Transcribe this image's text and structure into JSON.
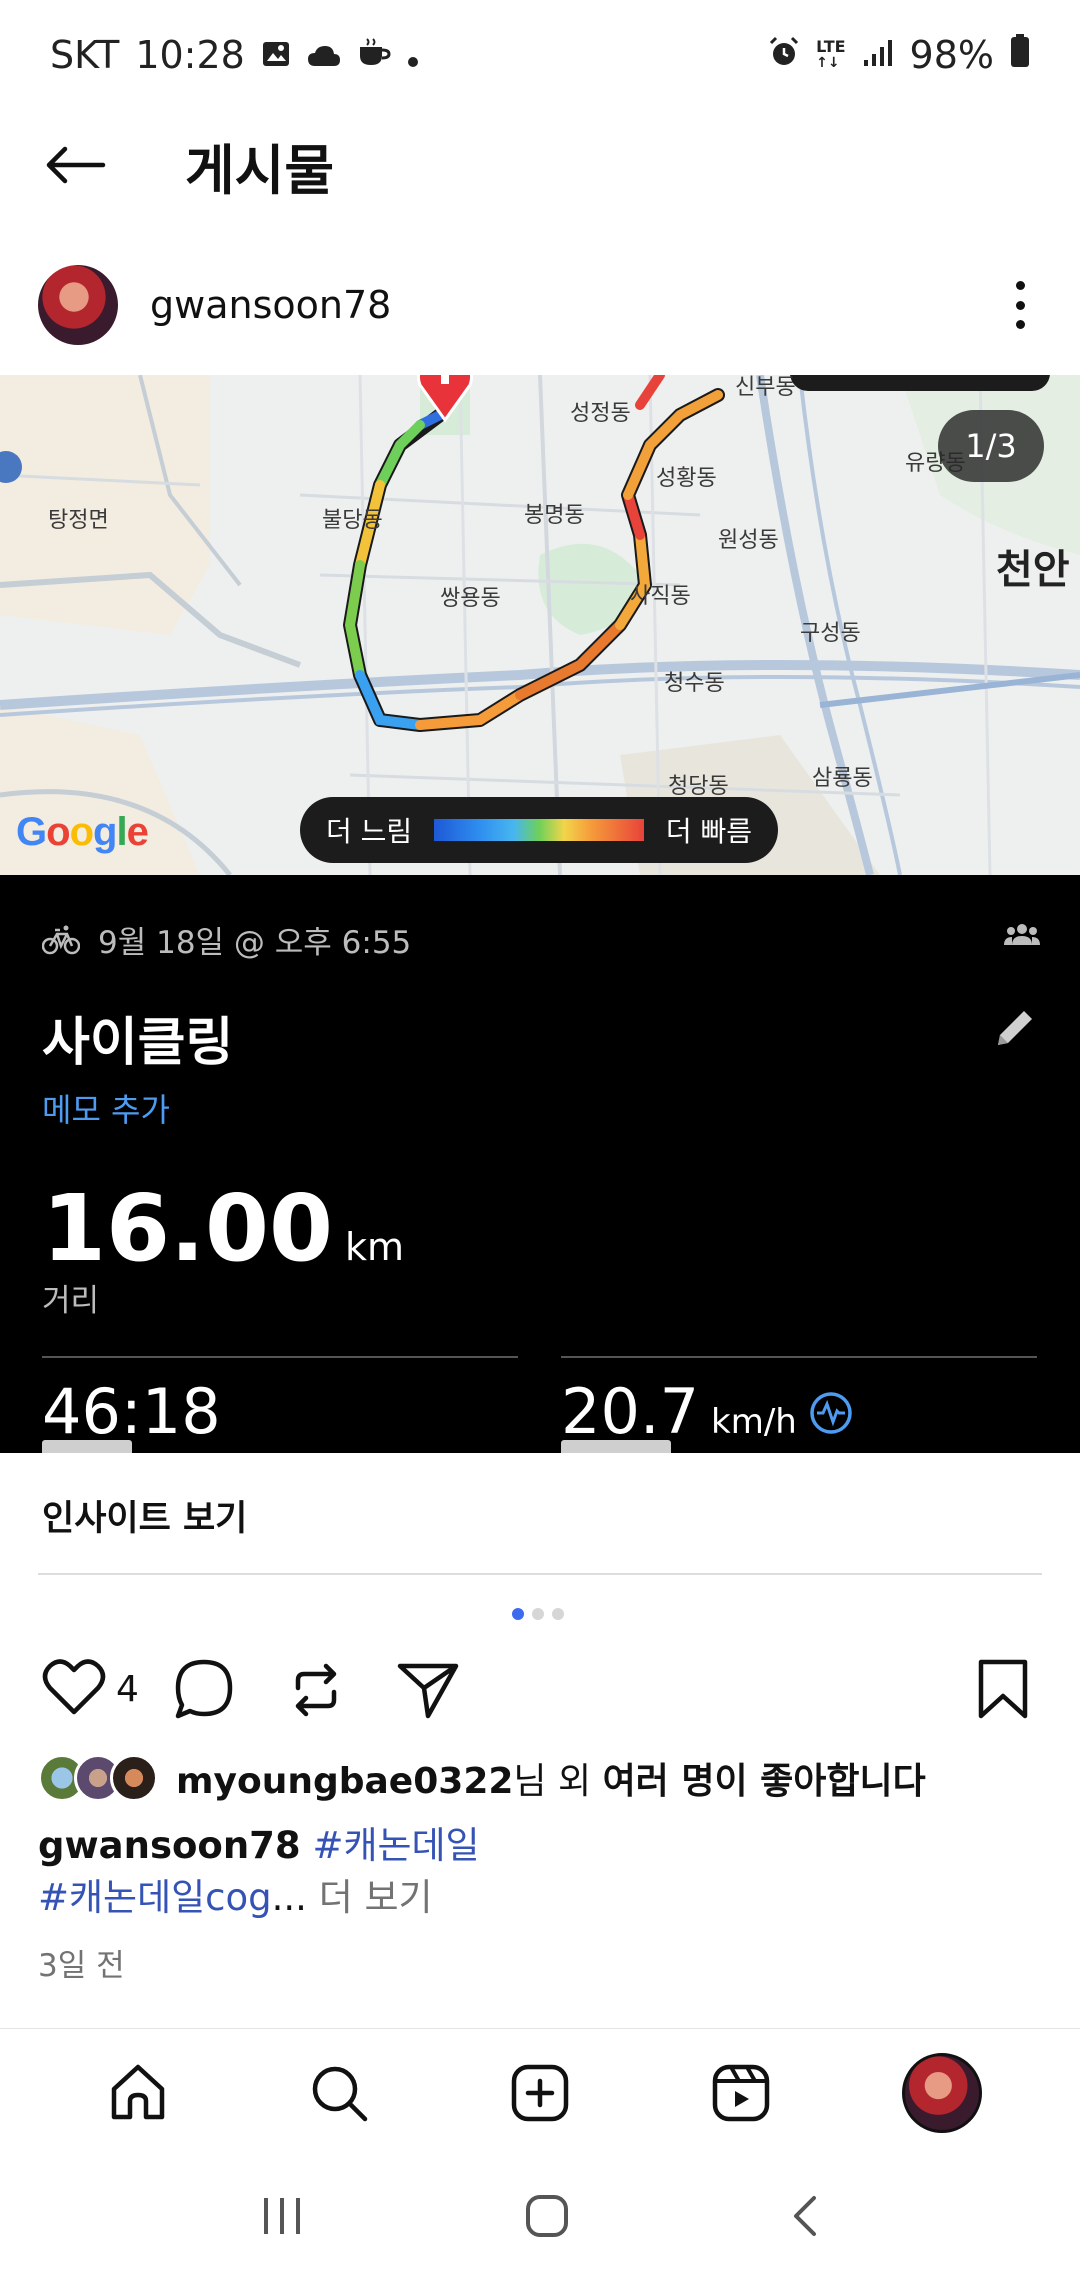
{
  "status_bar": {
    "carrier": "SKT",
    "time": "10:28",
    "network": "LTE",
    "battery": "98%"
  },
  "header": {
    "title": "게시물"
  },
  "author": {
    "username": "gwansoon78"
  },
  "map": {
    "page_indicator": "1/3",
    "google_logo": "Google",
    "legend_slow": "더 느림",
    "legend_fast": "더 빠름",
    "labels": [
      {
        "text": "성정동"
      },
      {
        "text": "신부동"
      },
      {
        "text": "유량동"
      },
      {
        "text": "탕정면"
      },
      {
        "text": "불당동"
      },
      {
        "text": "봉명동"
      },
      {
        "text": "성황동"
      },
      {
        "text": "원성동"
      },
      {
        "text": "천안"
      },
      {
        "text": "쌍용동"
      },
      {
        "text": "사직동"
      },
      {
        "text": "구성동"
      },
      {
        "text": "청수동"
      },
      {
        "text": "청당동"
      },
      {
        "text": "삼룡동"
      }
    ]
  },
  "activity": {
    "date": "9월 18일 @ 오후 6:55",
    "title": "사이클링",
    "memo_link": "메모 추가",
    "distance_value": "16.00",
    "distance_unit": "km",
    "distance_label": "거리",
    "duration": "46:18",
    "avg_speed": "20.7",
    "avg_speed_unit": "km/h"
  },
  "insight": {
    "label": "인사이트 보기"
  },
  "carousel": {
    "count": 3,
    "active": 1
  },
  "actions": {
    "like_count": "4"
  },
  "likes": {
    "username": "myoungbae0322",
    "suffix": "님 외 ",
    "others": "여러 명이 좋아합니다"
  },
  "caption": {
    "username": "gwansoon78",
    "tag1": "#캐논데일",
    "tag2": "#캐논데일cog",
    "ellipsis": "...",
    "more": " 더 보기"
  },
  "post_time": "3일 전",
  "colors": {
    "accent_blue": "#4e9cf2",
    "hashtag": "#3553b5",
    "card_bg": "#000000"
  }
}
